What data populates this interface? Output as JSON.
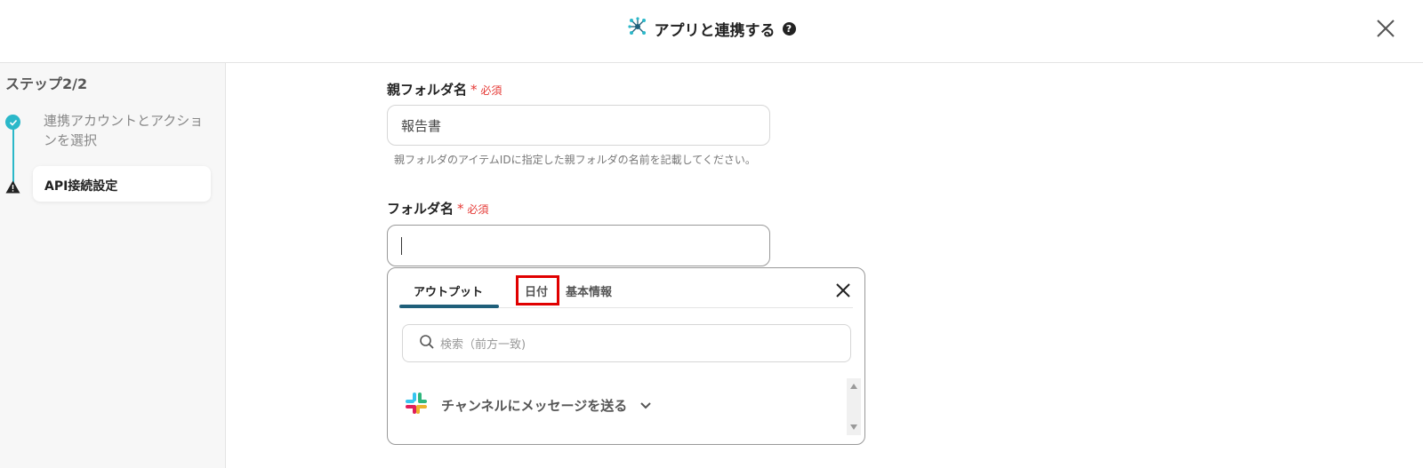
{
  "header": {
    "title": "アプリと連携する",
    "help_icon": "?",
    "icons": {
      "app_icon": "network-icon",
      "close": "close-icon"
    }
  },
  "sidebar": {
    "step_label": "ステップ2/2",
    "steps": [
      {
        "label": "連携アカウントとアクションを選択",
        "status": "done"
      },
      {
        "label": "API接続設定",
        "status": "warning"
      }
    ]
  },
  "form": {
    "parent_folder": {
      "label": "親フォルダ名",
      "required_star": "*",
      "required_text": "必須",
      "value": "報告書",
      "hint": "親フォルダのアイテムIDに指定した親フォルダの名前を記載してください。"
    },
    "folder": {
      "label": "フォルダ名",
      "required_star": "*",
      "required_text": "必須",
      "value": ""
    }
  },
  "popover": {
    "tabs": [
      {
        "label": "アウトプット",
        "active": true
      },
      {
        "label": "日付",
        "active": false
      },
      {
        "label": "基本情報",
        "active": false
      }
    ],
    "search_placeholder": "検索（前方一致)",
    "items": [
      {
        "label": "チャンネルにメッセージを送る",
        "icon": "slack-icon"
      }
    ]
  },
  "colors": {
    "accent": "#2bb8c9",
    "tab_underline": "#1f5f7a",
    "required": "#e53935",
    "highlight": "#e00000"
  }
}
